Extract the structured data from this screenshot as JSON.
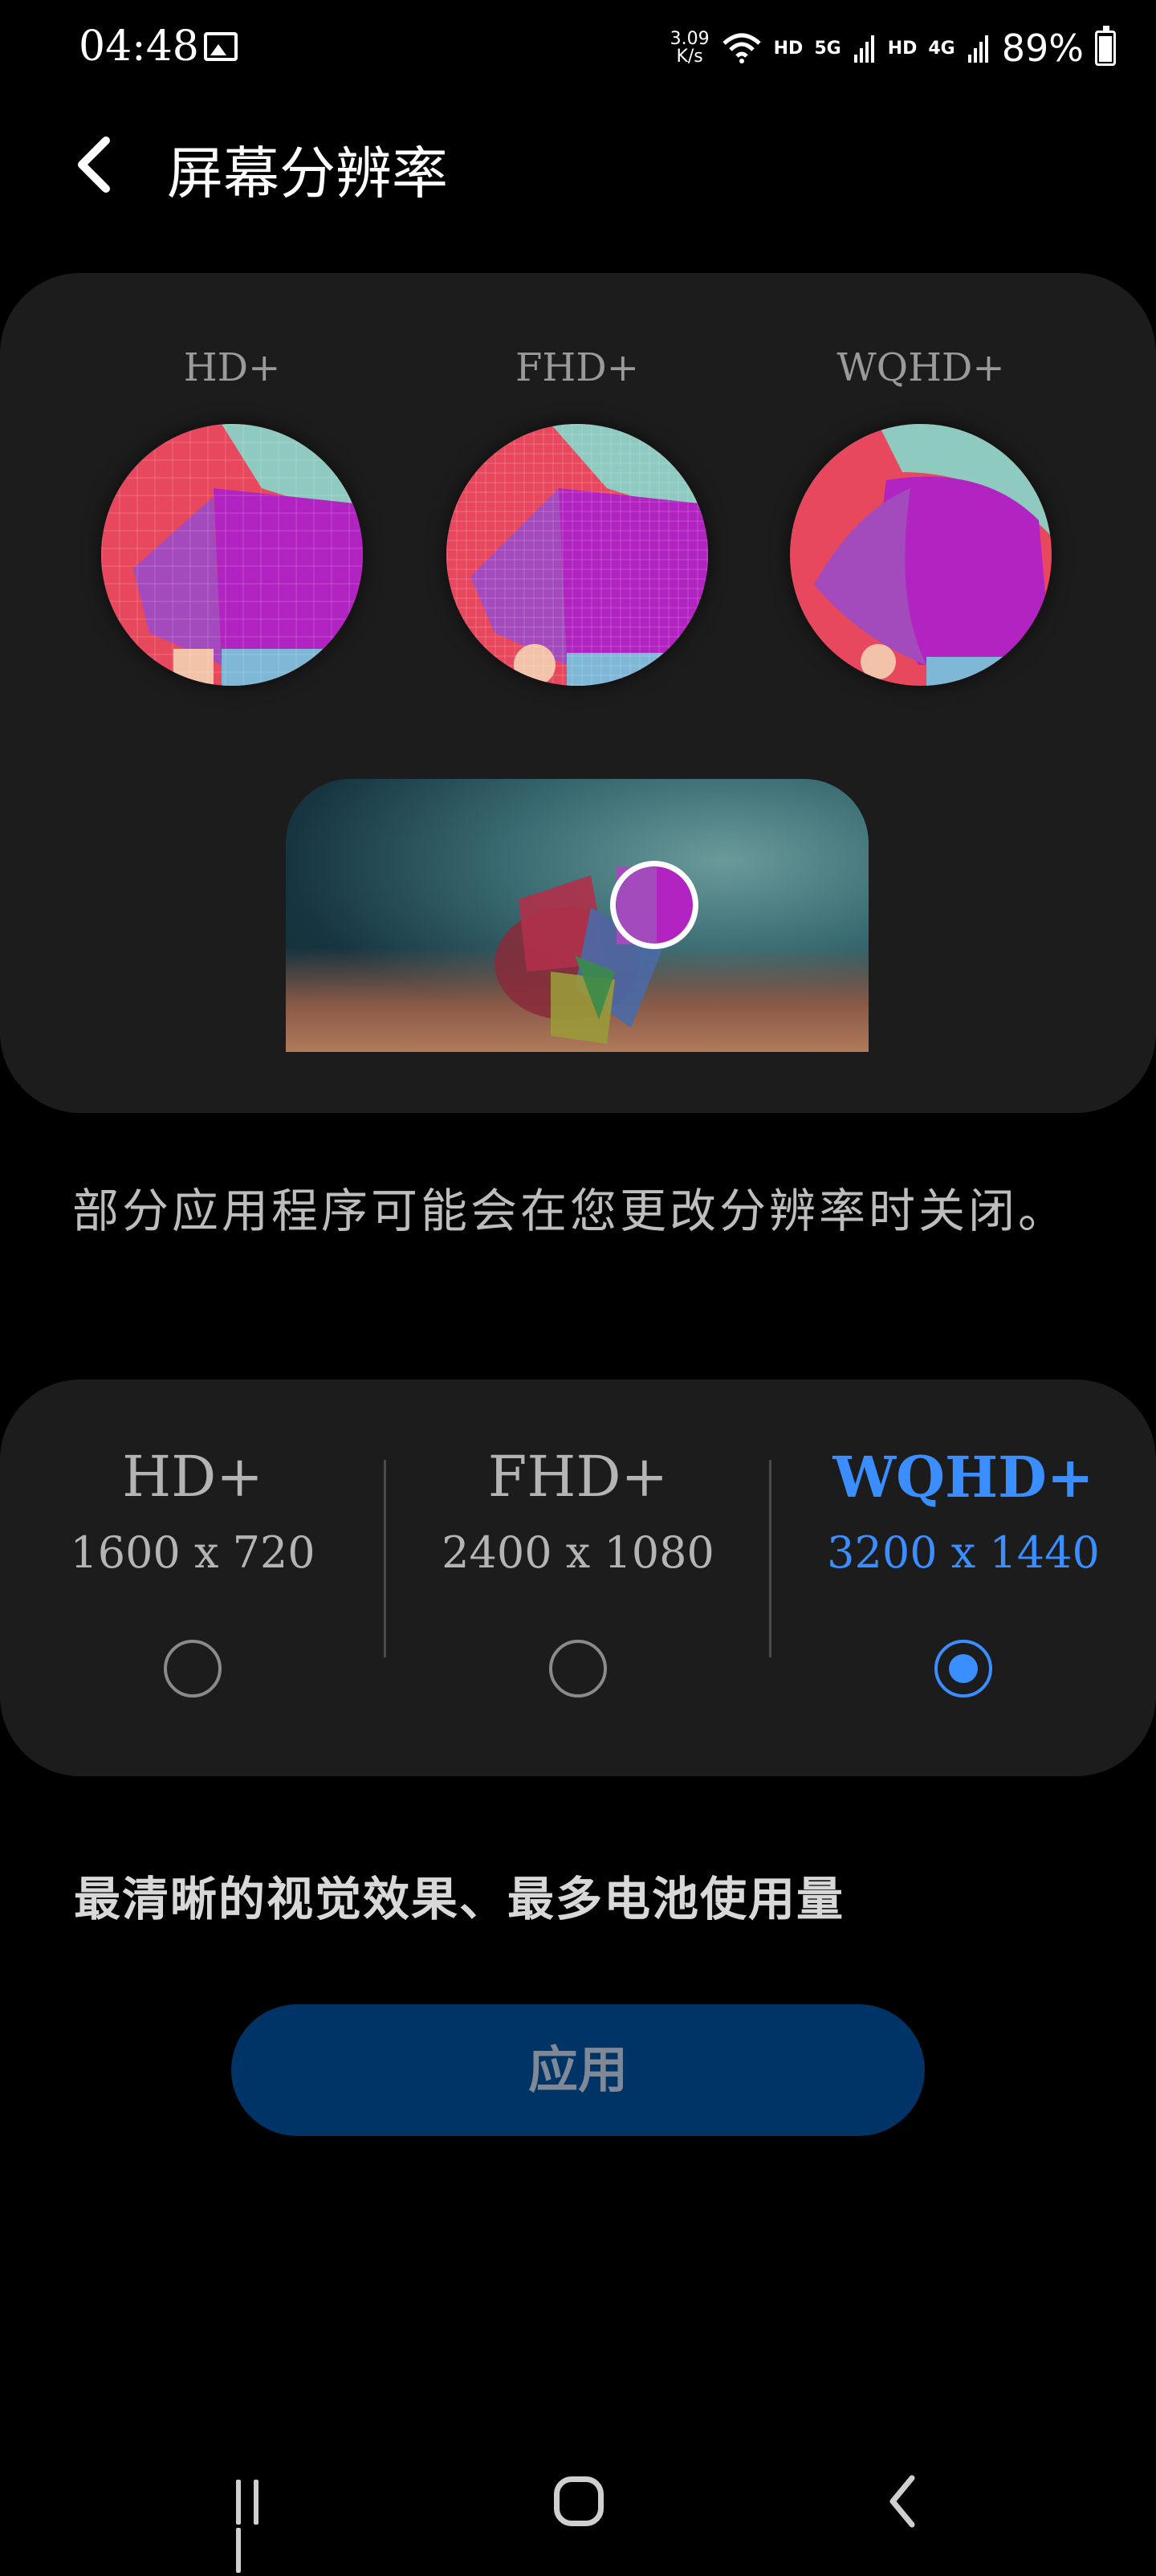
{
  "status_bar": {
    "time": "04:48",
    "net_speed_value": "3.09",
    "net_speed_unit": "K/s",
    "hd1": "HD",
    "net1": "5G",
    "hd2": "HD",
    "net2": "4G",
    "battery": "89%"
  },
  "header": {
    "title": "屏幕分辨率"
  },
  "preview": {
    "labels": [
      "HD+",
      "FHD+",
      "WQHD+"
    ]
  },
  "warning": "部分应用程序可能会在您更改分辨率时关闭。",
  "options": [
    {
      "name": "HD+",
      "dims": "1600 x 720",
      "selected": false
    },
    {
      "name": "FHD+",
      "dims": "2400 x 1080",
      "selected": false
    },
    {
      "name": "WQHD+",
      "dims": "3200 x 1440",
      "selected": true
    }
  ],
  "summary": "最清晰的视觉效果、最多电池使用量",
  "apply_label": "应用",
  "colors": {
    "accent": "#3a8eff",
    "apply_bg": "#003366",
    "card_bg": "#1c1c1c"
  }
}
